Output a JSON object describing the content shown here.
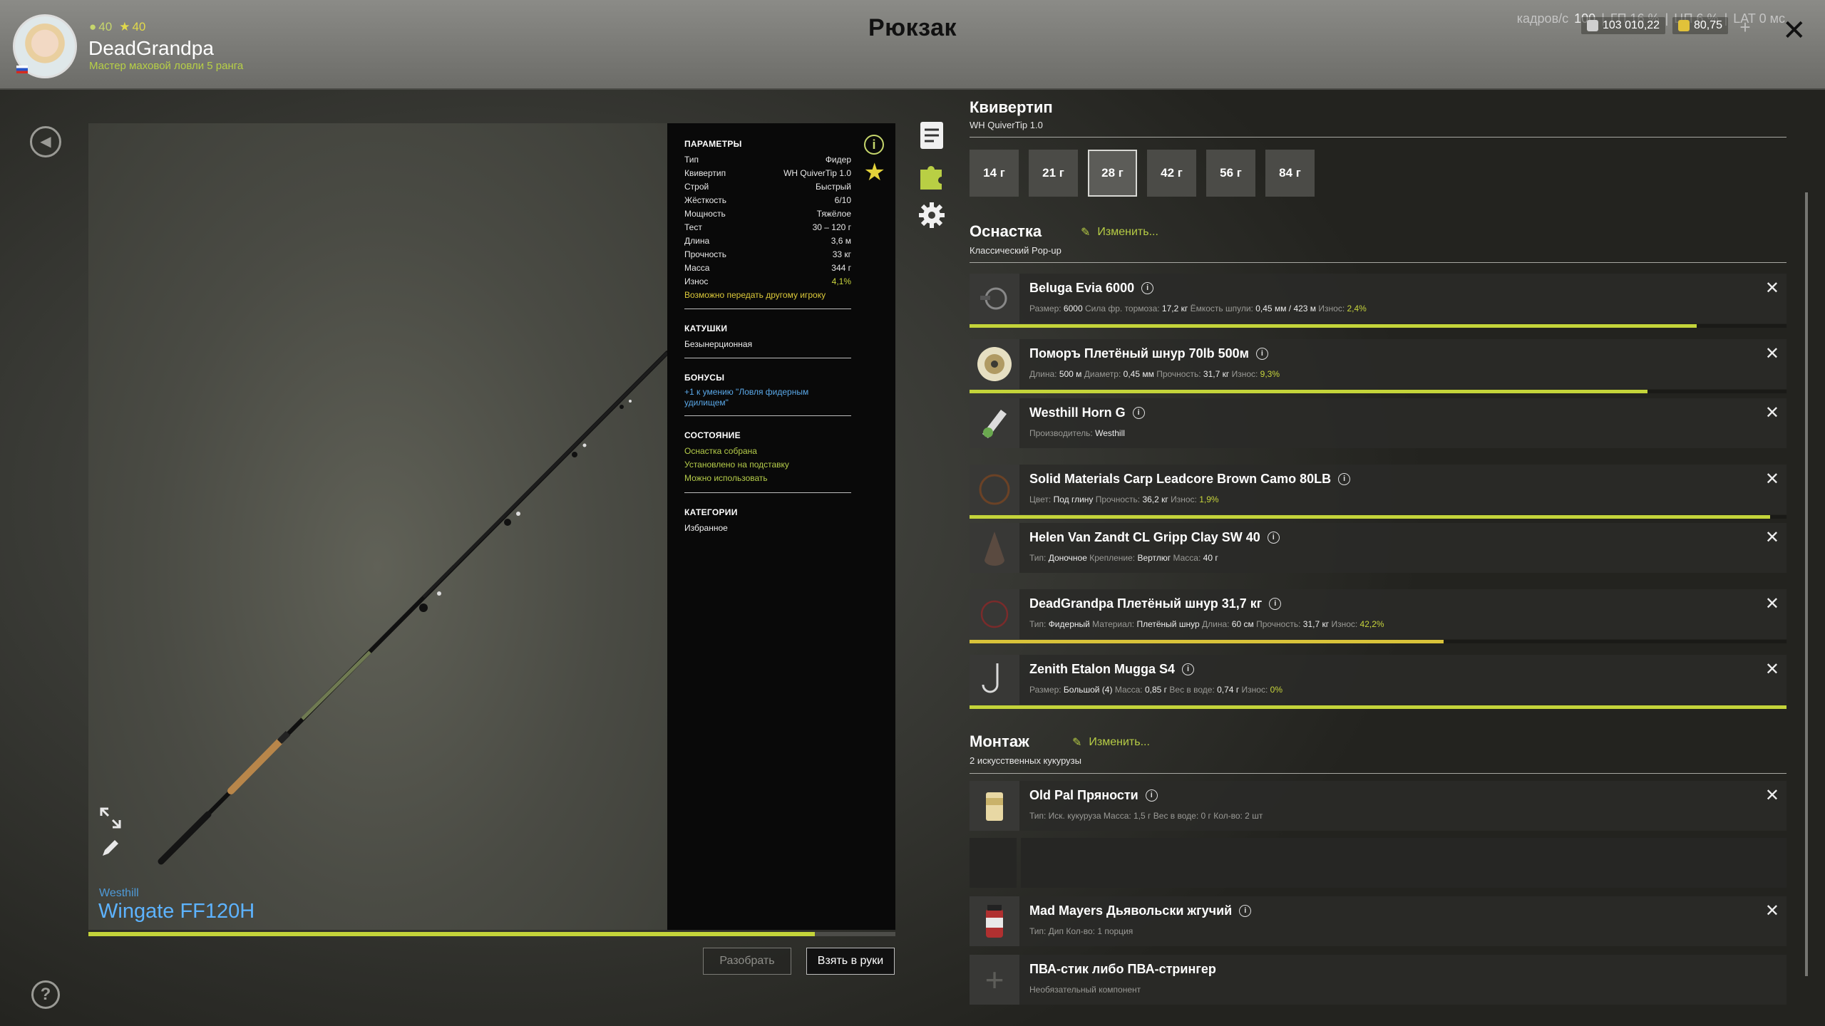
{
  "header": {
    "title": "Рюкзак",
    "player": {
      "name": "DeadGrandpa",
      "subtitle": "Мастер маховой ловли 5 ранга",
      "level_a": "40",
      "level_b": "40"
    },
    "perf": {
      "fps_label": "кадров/с",
      "fps": "100",
      "gpu": "ГП 16 %",
      "cpu": "ЦП 6 %",
      "lat": "LAT 0 мс"
    },
    "silver": "103 010,22",
    "gold": "80,75"
  },
  "rod": {
    "brand": "Westhill",
    "name": "Wingate FF120H",
    "wear_fraction": 0.9
  },
  "params": {
    "section_title": "ПАРАМЕТРЫ",
    "rows": [
      {
        "k": "Тип",
        "v": "Фидер"
      },
      {
        "k": "Квивертип",
        "v": "WH QuiverTip 1.0"
      },
      {
        "k": "Строй",
        "v": "Быстрый"
      },
      {
        "k": "Жёсткость",
        "v": "6/10"
      },
      {
        "k": "Мощность",
        "v": "Тяжёлое"
      },
      {
        "k": "Тест",
        "v": "30 – 120 г"
      },
      {
        "k": "Длина",
        "v": "3,6 м"
      },
      {
        "k": "Прочность",
        "v": "33 кг"
      },
      {
        "k": "Масса",
        "v": "344 г"
      },
      {
        "k": "Износ",
        "v": "4,1%"
      }
    ],
    "transfer_note": "Возможно передать другому игроку",
    "reels_title": "КАТУШКИ",
    "reels_value": "Безынерционная",
    "bonuses_title": "БОНУСЫ",
    "bonus_line1": "+1 к умению \"Ловля фидерным",
    "bonus_line2": "удилищем\"",
    "state_title": "СОСТОЯНИЕ",
    "state_items": [
      "Оснастка собрана",
      "Установлено на подставку",
      "Можно использовать"
    ],
    "categories_title": "КАТЕГОРИИ",
    "categories_value": "Избранное"
  },
  "buttons": {
    "disassemble": "Разобрать",
    "take": "Взять в руки"
  },
  "quivertip": {
    "title": "Квивертип",
    "subtitle": "WH QuiverTip 1.0",
    "weights": [
      "14 г",
      "21 г",
      "28 г",
      "42 г",
      "56 г",
      "84 г"
    ],
    "selected": "28 г"
  },
  "rig": {
    "title": "Оснастка",
    "change": "Изменить...",
    "subtitle": "Классический Pop-up",
    "items": [
      {
        "name": "Beluga Evia 6000",
        "desc": [
          [
            "Размер:",
            "6000"
          ],
          [
            "Сила фр. тормоза:",
            "17,2 кг"
          ],
          [
            "Ёмкость шпули:",
            "0,45 мм / 423 м"
          ]
        ],
        "wear": "2,4%",
        "fill": 0.89
      },
      {
        "name": "Поморъ Плетёный шнур 70lb 500м",
        "desc": [
          [
            "Длина:",
            "500 м"
          ],
          [
            "Диаметр:",
            "0,45 мм"
          ],
          [
            "Прочность:",
            "31,7 кг"
          ]
        ],
        "wear": "9,3%",
        "fill": 0.83
      },
      {
        "name": "Westhill Horn G",
        "desc": [
          [
            "Производитель:",
            "Westhill"
          ]
        ],
        "wear": "",
        "fill": 0
      },
      {
        "name": "Solid Materials Carp Leadcore Brown Camo 80LB",
        "desc": [
          [
            "Цвет:",
            "Под глину"
          ],
          [
            "Прочность:",
            "36,2 кг"
          ]
        ],
        "wear": "1,9%",
        "fill": 0.98
      },
      {
        "name": "Helen Van Zandt CL Gripp Clay SW 40",
        "desc": [
          [
            "Тип:",
            "Доночное"
          ],
          [
            "Крепление:",
            "Вертлюг"
          ],
          [
            "Масса:",
            "40 г"
          ]
        ],
        "wear": "",
        "fill": 0
      },
      {
        "name": "DeadGrandpa Плетёный шнур 31,7 кг",
        "desc": [
          [
            "Тип:",
            "Фидерный"
          ],
          [
            "Материал:",
            "Плетёный шнур"
          ],
          [
            "Длина:",
            "60 см"
          ],
          [
            "Прочность:",
            "31,7 кг"
          ]
        ],
        "wear": "42,2%",
        "fill": 0.58
      },
      {
        "name": "Zenith Etalon Mugga S4",
        "desc": [
          [
            "Размер:",
            "Большой (4)"
          ],
          [
            "Масса:",
            "0,85 г"
          ],
          [
            "Вес в воде:",
            "0,74 г"
          ]
        ],
        "wear": "0%",
        "fill": 1.0
      }
    ]
  },
  "mount": {
    "title": "Монтаж",
    "change": "Изменить...",
    "subtitle": "2 искусственных кукурузы",
    "items": [
      {
        "name": "Old Pal Пряности",
        "desc": "Тип: Иск. кукуруза  Масса: 1,5 г  Вес в воде: 0 г  Кол-во: 2 шт"
      },
      {
        "name": "Mad Mayers Дьявольски жгучий",
        "desc": "Тип: Дип  Кол-во: 1 порция"
      },
      {
        "name": "ПВА-стик либо ПВА-стрингер",
        "desc": "Необязательный компонент"
      }
    ]
  },
  "labels": {
    "wear": "Износ:"
  }
}
